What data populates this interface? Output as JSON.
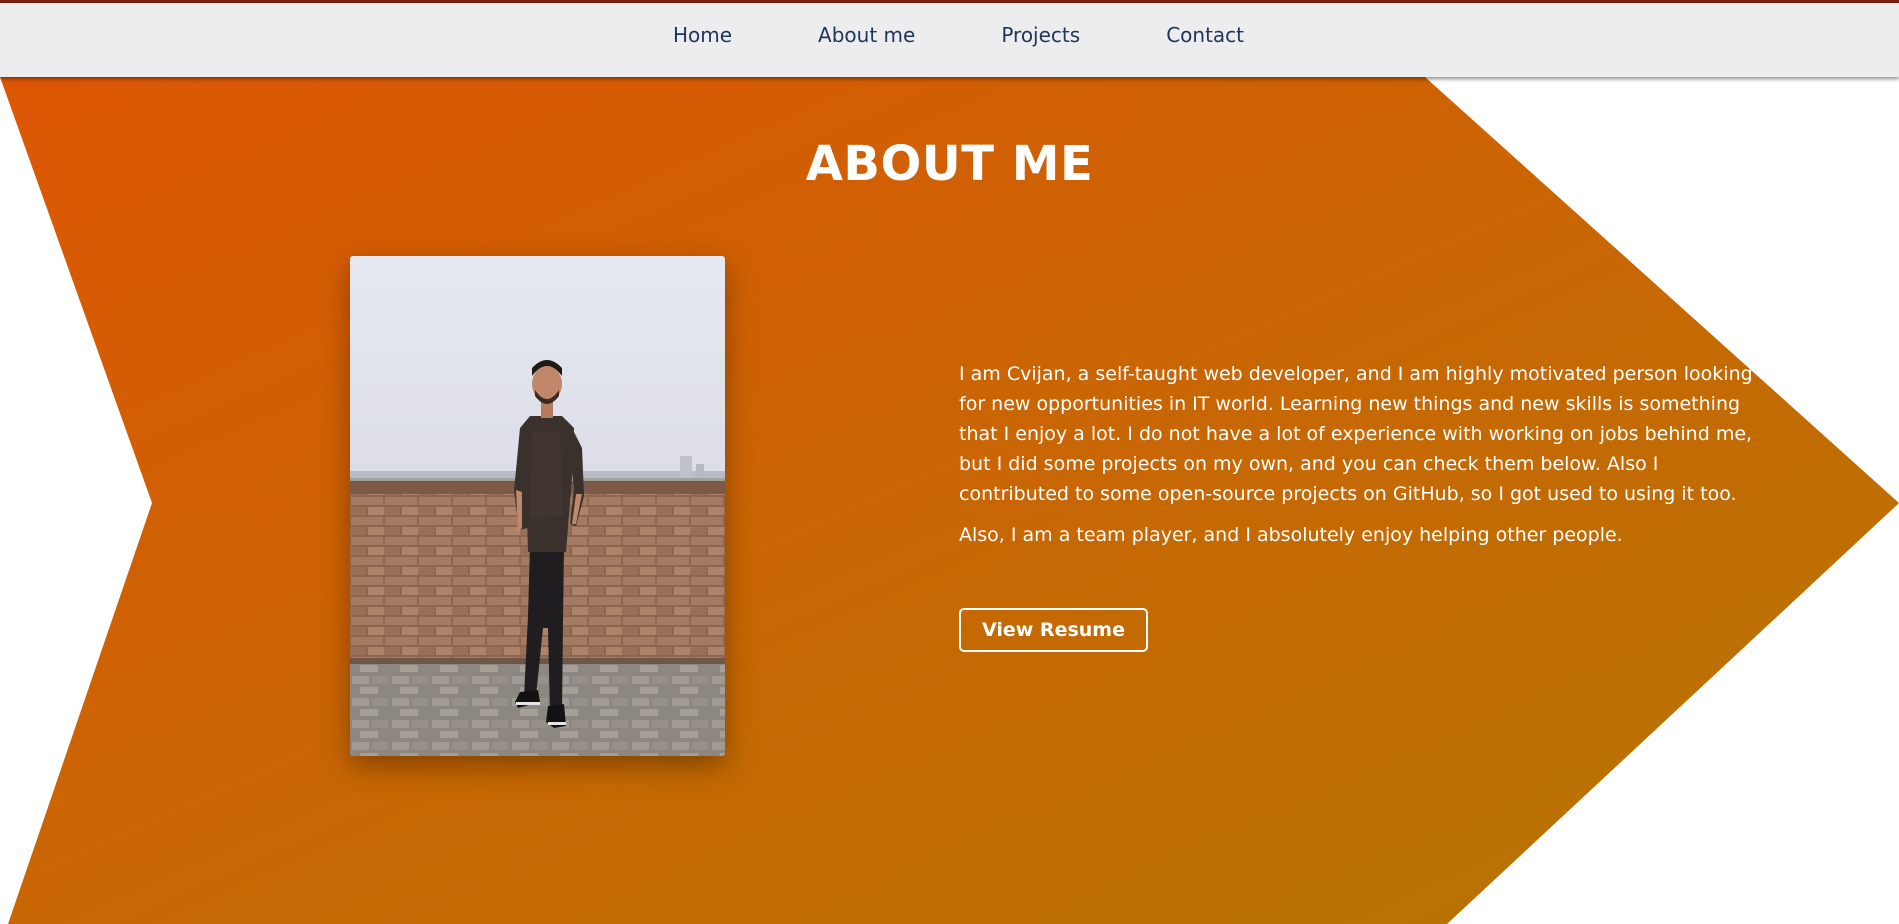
{
  "nav": {
    "items": [
      {
        "label": "Home"
      },
      {
        "label": "About me"
      },
      {
        "label": "Projects"
      },
      {
        "label": "Contact"
      }
    ]
  },
  "about": {
    "title": "ABOUT ME",
    "paragraphs": [
      "I am Cvijan, a self-taught web developer, and I am highly motivated person looking for new opportunities in IT world. Learning new things and new skills is something that I enjoy a lot. I do not have a lot of experience with working on jobs behind me, but I did some projects on my own, and you can check them below. Also I contributed to some open-source projects on GitHub, so I got used to using it too.",
      "Also, I am a team player, and I absolutely enjoy helping other people."
    ],
    "resume_label": "View Resume"
  },
  "colors": {
    "nav_bg": "#edecee",
    "nav_text": "#1f3658",
    "nav_top_border": "#7a1c14",
    "gradient_start": "#dd5604",
    "gradient_end": "#b47602",
    "text_on_accent": "#ffffff"
  }
}
